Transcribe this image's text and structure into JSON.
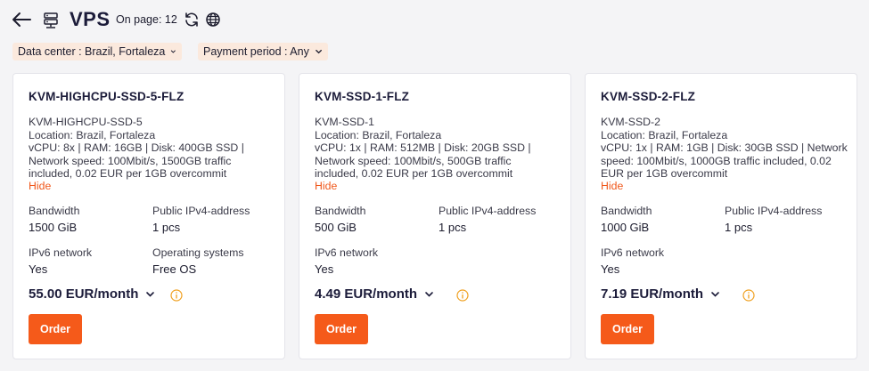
{
  "header": {
    "title": "VPS",
    "on_page": "On page: 12"
  },
  "filters": {
    "data_center": "Data center : Brazil, Fortaleza",
    "payment_period": "Payment period : Any"
  },
  "cards": [
    {
      "title": "KVM-HIGHCPU-SSD-5-FLZ",
      "description": "KVM-HIGHCPU-SSD-5\nLocation: Brazil, Fortaleza\nvCPU: 8x | RAM: 16GB | Disk: 400GB SSD |\nNetwork speed: 100Mbit/s, 1500GB traffic\nincluded, 0.02 EUR per 1GB overcommit",
      "hide": "Hide",
      "bandwidth_label": "Bandwidth",
      "bandwidth_value": "1500 GiB",
      "ipv4_label": "Public IPv4-address",
      "ipv4_value": "1 pcs",
      "ipv6_label": "IPv6 network",
      "ipv6_value": "Yes",
      "os_label": "Operating systems",
      "os_value": "Free OS",
      "price": "55.00 EUR/month",
      "order": "Order"
    },
    {
      "title": "KVM-SSD-1-FLZ",
      "description": "KVM-SSD-1\nLocation: Brazil, Fortaleza\nvCPU: 1x | RAM: 512MB | Disk: 20GB SSD |\nNetwork speed: 100Mbit/s, 500GB traffic\nincluded, 0.02 EUR per 1GB overcommit",
      "hide": "Hide",
      "bandwidth_label": "Bandwidth",
      "bandwidth_value": "500 GiB",
      "ipv4_label": "Public IPv4-address",
      "ipv4_value": "1 pcs",
      "ipv6_label": "IPv6 network",
      "ipv6_value": "Yes",
      "price": "4.49 EUR/month",
      "order": "Order"
    },
    {
      "title": "KVM-SSD-2-FLZ",
      "description": "KVM-SSD-2\nLocation: Brazil, Fortaleza\nvCPU: 1x | RAM: 1GB | Disk: 30GB SSD | Network\nspeed: 100Mbit/s, 1000GB traffic included, 0.02\nEUR per 1GB overcommit",
      "hide": "Hide",
      "bandwidth_label": "Bandwidth",
      "bandwidth_value": "1000 GiB",
      "ipv4_label": "Public IPv4-address",
      "ipv4_value": "1 pcs",
      "ipv6_label": "IPv6 network",
      "ipv6_value": "Yes",
      "price": "7.19 EUR/month",
      "order": "Order"
    }
  ],
  "icons": {
    "back": "arrow-left-icon",
    "server": "server-icon",
    "refresh": "refresh-icon",
    "language": "globe-icon",
    "price_info": "info-icon"
  },
  "colors": {
    "accent": "#f55a1a",
    "link": "#f0571a",
    "filter_bg": "#fbe9dd",
    "info": "#f0a020"
  }
}
